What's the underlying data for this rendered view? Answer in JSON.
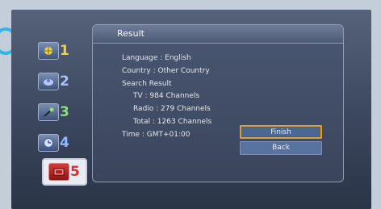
{
  "colors": {
    "background": "#c4cedb",
    "screen": "#3d4960",
    "panel": "#3a455c",
    "focus_border": "#d8a23a",
    "active_step": "#e9ecf2"
  },
  "steps": [
    {
      "number": "1",
      "icon": "globe-icon",
      "color": "#e8d44a"
    },
    {
      "number": "2",
      "icon": "satellite-icon",
      "color": "#a8c0ff"
    },
    {
      "number": "3",
      "icon": "antenna-icon",
      "color": "#8fe07a"
    },
    {
      "number": "4",
      "icon": "clock-icon",
      "color": "#8fb8ff"
    },
    {
      "number": "5",
      "icon": "tv-icon",
      "color": "#d23030",
      "active": true
    }
  ],
  "panel": {
    "title": "Result",
    "language": "Language : English",
    "country": "Country : Other Country",
    "search_result": "Search Result",
    "tv": "TV : 984 Channels",
    "radio": "Radio : 279 Channels",
    "total": "Total : 1263 Channels",
    "time": "Time : GMT+01:00"
  },
  "buttons": {
    "finish": "Finish",
    "back": "Back"
  }
}
